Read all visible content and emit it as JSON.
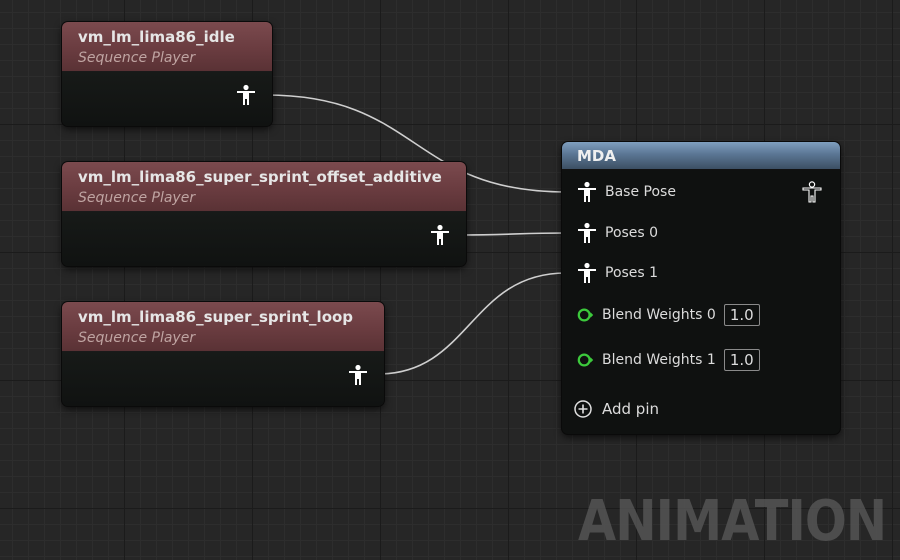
{
  "nodes": [
    {
      "title": "vm_lm_lima86_idle",
      "subtitle": "Sequence Player"
    },
    {
      "title": "vm_lm_lima86_super_sprint_offset_additive",
      "subtitle": "Sequence Player"
    },
    {
      "title": "vm_lm_lima86_super_sprint_loop",
      "subtitle": "Sequence Player"
    }
  ],
  "mda": {
    "title": "MDA",
    "pins": [
      "Base Pose",
      "Poses 0",
      "Poses 1"
    ],
    "weights": [
      {
        "label": "Blend Weights 0",
        "value": "1.0"
      },
      {
        "label": "Blend Weights 1",
        "value": "1.0"
      }
    ],
    "add_pin": "Add pin"
  },
  "watermark": "ANIMATION",
  "icons": {
    "pose": "pose-pin-icon",
    "float": "float-pin-icon",
    "add": "add-pin-icon"
  },
  "colors": {
    "pose_pin": "#ffffff",
    "float_pin": "#3cc93c",
    "sequence_header": "#7b4a4e",
    "mda_header": "#5b7694",
    "wire": "#cfcfcf"
  }
}
